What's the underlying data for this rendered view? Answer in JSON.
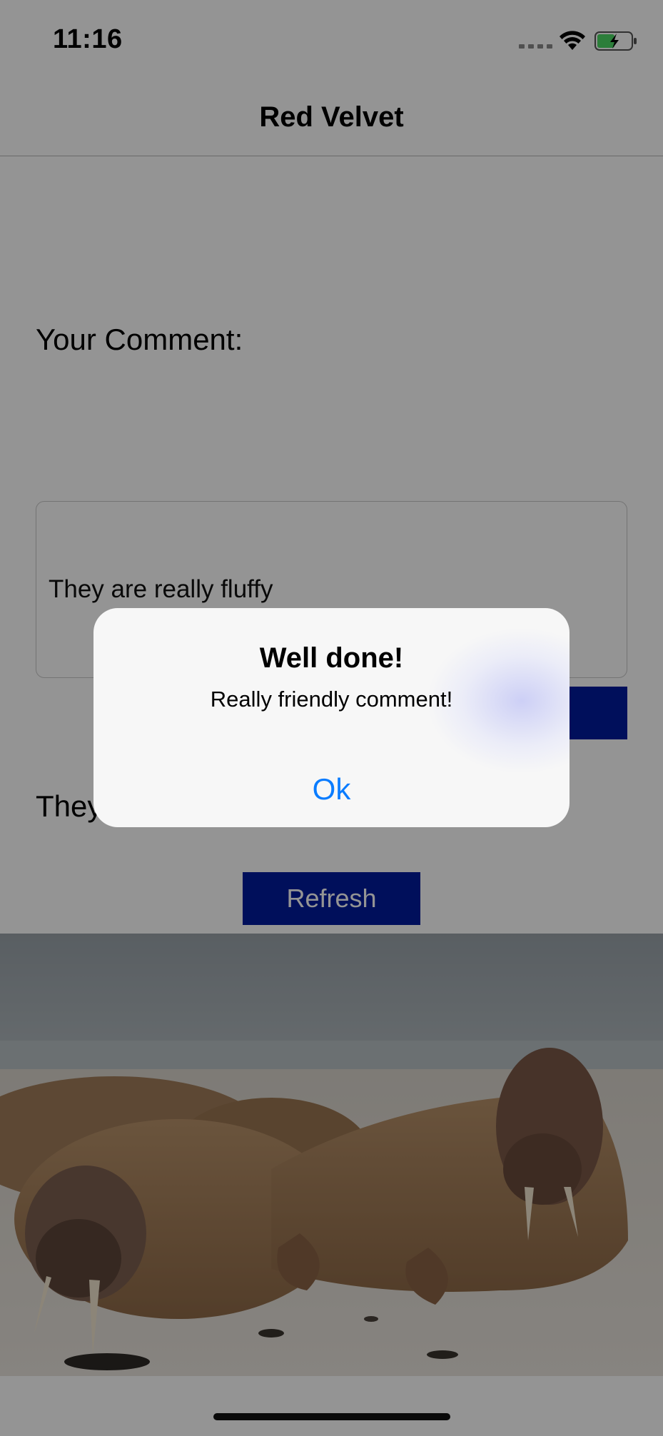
{
  "status_bar": {
    "time": "11:16",
    "icons": [
      "cellular-signal-icon",
      "wifi-icon",
      "battery-charging-icon"
    ]
  },
  "nav": {
    "title": "Red Velvet"
  },
  "form": {
    "comment_label": "Your Comment:",
    "comment_value": "They are really fluffy",
    "result_text": "They",
    "refresh_label": "Refresh"
  },
  "image": {
    "subject": "walrus-photo"
  },
  "alert": {
    "title": "Well done!",
    "message": "Really friendly comment!",
    "ok_label": "Ok"
  },
  "colors": {
    "button_bg": "#001a9e",
    "alert_action": "#0a7cff",
    "dim_overlay": "rgba(0,0,0,0.42)"
  }
}
